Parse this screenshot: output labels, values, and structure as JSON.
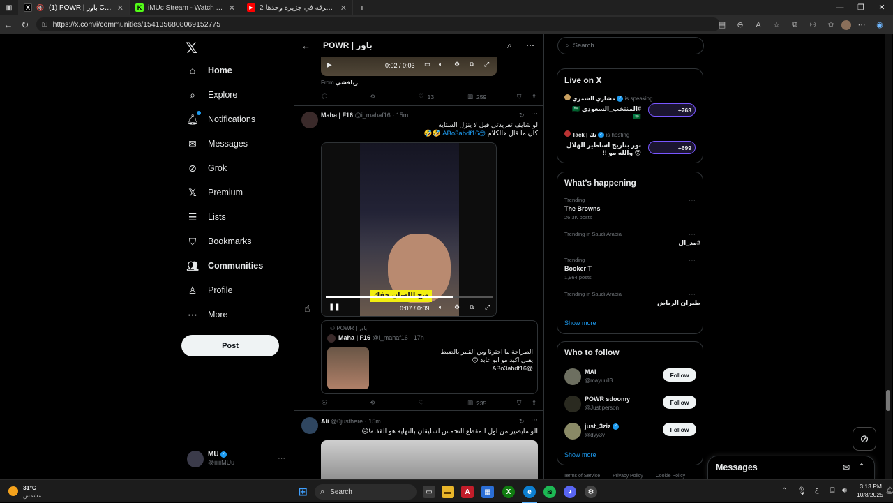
{
  "browser": {
    "tabs": [
      {
        "title": "(1) POWR | باور Community / X",
        "icon": "x-logo-icon",
        "active": true
      },
      {
        "title": "iMUc Stream - Watch Live on Kick",
        "icon": "kick-icon",
        "active": false
      },
      {
        "title": "كل الأفرقه في جزيرة وحدها 2# - be",
        "icon": "youtube-icon",
        "active": false
      }
    ],
    "new_tab_label": "+",
    "url": "https://x.com/i/communities/1541356808069152775"
  },
  "nav": {
    "items": [
      {
        "label": "Home",
        "icon": "home-icon"
      },
      {
        "label": "Explore",
        "icon": "search-icon"
      },
      {
        "label": "Notifications",
        "icon": "bell-icon"
      },
      {
        "label": "Messages",
        "icon": "envelope-icon"
      },
      {
        "label": "Grok",
        "icon": "grok-icon"
      },
      {
        "label": "Premium",
        "icon": "x-logo-icon"
      },
      {
        "label": "Lists",
        "icon": "list-icon"
      },
      {
        "label": "Bookmarks",
        "icon": "bookmark-icon"
      },
      {
        "label": "Communities",
        "icon": "people-icon"
      },
      {
        "label": "Profile",
        "icon": "person-icon"
      },
      {
        "label": "More",
        "icon": "more-circle-icon"
      }
    ],
    "post_button": "Post",
    "account": {
      "name": "MU",
      "handle": "@iiiiiMUu"
    }
  },
  "center": {
    "title": "POWR | باور",
    "top_video": {
      "time": "0:02 / 0:03",
      "from_label": "From",
      "from_name": "ريافشي"
    },
    "top_actions": {
      "likes": "13",
      "views": "259"
    },
    "post1": {
      "name": "Maha | F16",
      "handle": "@i_mahaf16",
      "time": "15m",
      "text_line1": "لو شايف تغريدتي قبل لا ينزل الستايه",
      "text_line2": "كان ما قال هالكلام",
      "mention": "@ABo3abdf16",
      "emoji": "🤣🤣",
      "video_time": "0:07 / 0:09",
      "caption": "صح اللسان حقك",
      "quote": {
        "community": "POWR | باور",
        "name": "Maha | F16",
        "handle": "@i_mahaf16",
        "time": "17h",
        "line1": "الصراحة ما احترنا وين القمر بالضبط",
        "line2": "يعني اكيد مو ابو عابد 🙃",
        "line3": "@ABo3abdf16"
      },
      "views": "235"
    },
    "post2": {
      "name": "Ali",
      "handle": "@0justhere",
      "time": "15m",
      "text": "الو مايصير من اول المقطع التحمس لسليقان بالنهايه هو القفله!😢"
    }
  },
  "right": {
    "search_placeholder": "Search",
    "live": {
      "title": "Live on X",
      "items": [
        {
          "host": "مشاري الشمري",
          "status": "is speaking",
          "title": "#المنتخب_السعودي 🇸🇦 🇸🇦",
          "count": "+763"
        },
        {
          "host": "Tack | تك",
          "status": "is hosting",
          "title": "نور بتاريخ اساطير الهلال 😮 والله مو !!",
          "count": "+699"
        }
      ]
    },
    "happening": {
      "title": "What’s happening",
      "items": [
        {
          "context": "Trending",
          "topic": "The Browns",
          "posts": "26.3K posts"
        },
        {
          "context": "Trending in Saudi Arabia",
          "topic": "#مد_ال",
          "posts": ""
        },
        {
          "context": "Trending",
          "topic": "Booker T",
          "posts": "1,964 posts"
        },
        {
          "context": "Trending in Saudi Arabia",
          "topic": "طيران الرياض",
          "posts": ""
        }
      ],
      "show_more": "Show more"
    },
    "follow": {
      "title": "Who to follow",
      "items": [
        {
          "name": "MAI",
          "handle": "@mayuuil3",
          "button": "Follow"
        },
        {
          "name": "POWR sdoomy",
          "handle": "@Justlperson",
          "button": "Follow"
        },
        {
          "name": "just_3ziz",
          "handle": "@dyy3v",
          "button": "Follow"
        }
      ],
      "show_more": "Show more"
    },
    "footer": [
      "Terms of Service",
      "Privacy Policy",
      "Cookie Policy"
    ],
    "messages_label": "Messages"
  },
  "taskbar": {
    "weather_temp": "31°C",
    "weather_desc": "مشمس",
    "search_label": "Search",
    "lang": "ع",
    "time": "3:13 PM",
    "date": "10/8/2025"
  },
  "colors": {
    "accent": "#1d9bf0",
    "bg": "#000000",
    "border": "#2f3336",
    "muted": "#71767b"
  }
}
